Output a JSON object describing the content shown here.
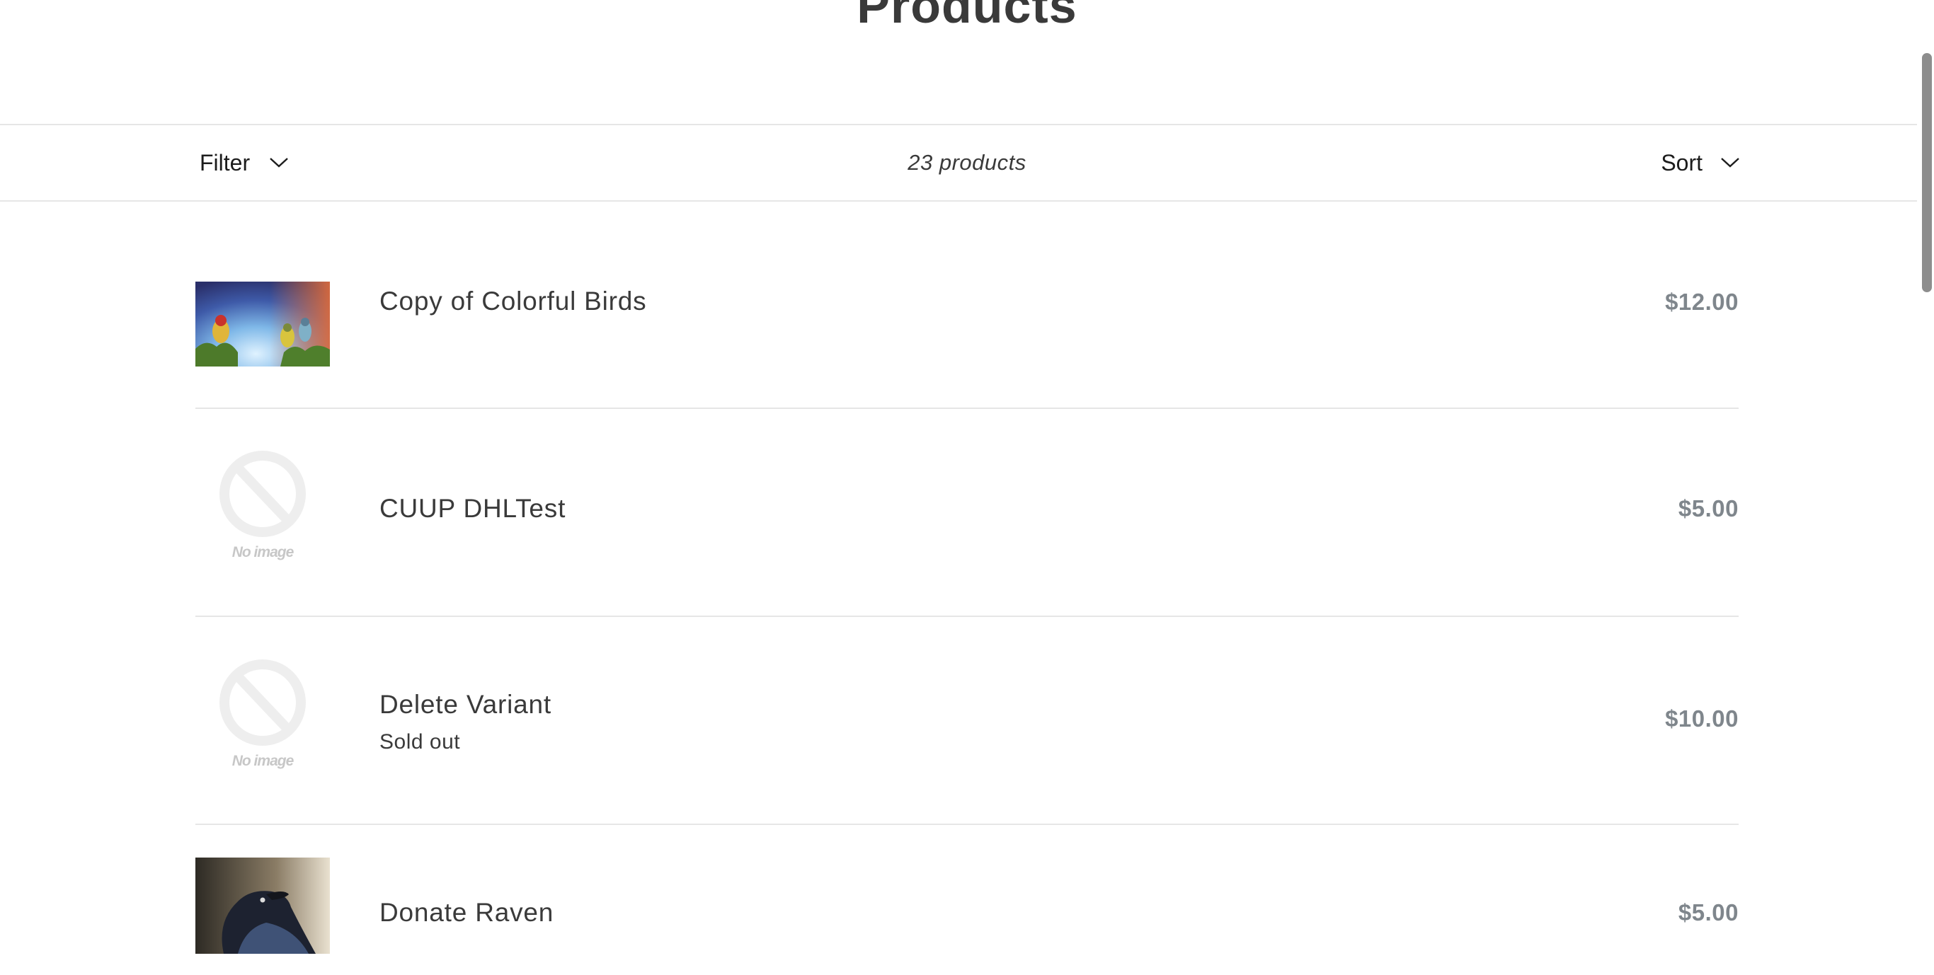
{
  "page": {
    "title": "Products"
  },
  "toolbar": {
    "filter_label": "Filter",
    "count_label": "23 products",
    "sort_label": "Sort"
  },
  "products": [
    {
      "name": "Copy of Colorful Birds",
      "price": "$12.00",
      "image": "colorful-birds-photo"
    },
    {
      "name": "CUUP DHLTest",
      "price": "$5.00",
      "image": "no-image-placeholder",
      "placeholder_text": "No image"
    },
    {
      "name": "Delete Variant",
      "status": "Sold out",
      "price": "$10.00",
      "image": "no-image-placeholder",
      "placeholder_text": "No image"
    },
    {
      "name": "Donate Raven",
      "price": "$5.00",
      "image": "raven-photo"
    }
  ],
  "colors": {
    "text": "#3a3a3a",
    "price": "#7f868c",
    "divider": "#e6e6e6",
    "placeholder": "#eeeeee",
    "scrollbar": "#8d8d8d"
  }
}
